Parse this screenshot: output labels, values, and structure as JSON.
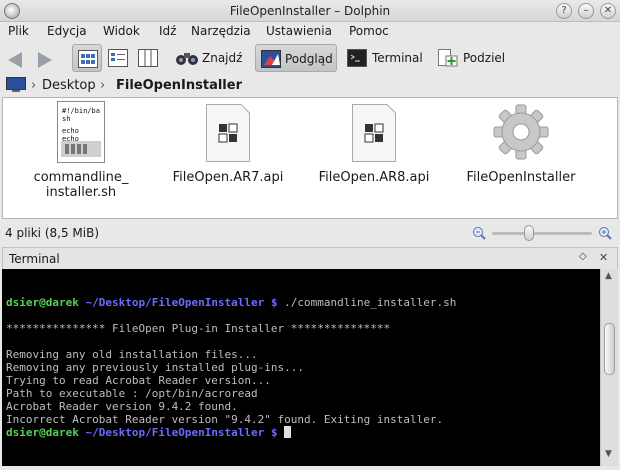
{
  "window": {
    "title": "FileOpenInstaller – Dolphin"
  },
  "menu": [
    "Plik",
    "Edycja",
    "Widok",
    "Idź",
    "Narzędzia",
    "Ustawienia",
    "Pomoc"
  ],
  "toolbar": {
    "find": "Znajdź",
    "preview": "Podgląd",
    "terminal": "Terminal",
    "split": "Podziel"
  },
  "breadcrumb": {
    "parent": "Desktop",
    "current": "FileOpenInstaller"
  },
  "files": [
    {
      "name_line1": "commandline_",
      "name_line2": "installer.sh",
      "preview_lines": [
        "#!/bin/ba",
        "sh",
        "echo",
        "echo"
      ]
    },
    {
      "name_line1": "FileOpen.AR7.api",
      "name_line2": ""
    },
    {
      "name_line1": "FileOpen.AR8.api",
      "name_line2": ""
    },
    {
      "name_line1": "FileOpenInstaller",
      "name_line2": ""
    }
  ],
  "status": {
    "text": "4 pliki (8,5 MiB)",
    "zoom_level": 0.35
  },
  "terminal_panel": {
    "title": "Terminal",
    "user": "dsier@darek",
    "path": "~/Desktop/FileOpenInstaller $",
    "command": " ./commandline_installer.sh",
    "banner": "*************** FileOpen Plug-in Installer ***************",
    "output": [
      "Removing any old installation files...",
      "Removing any previously installed plug-ins...",
      "Trying to read Acrobat Reader version...",
      "Path to executable : /opt/bin/acroread",
      "Acrobat Reader version 9.4.2 found.",
      "Incorrect Acrobat Reader version \"9.4.2\" found. Exiting installer."
    ]
  },
  "colors": {
    "prompt_user": "#55d255",
    "prompt_path": "#6b6bff",
    "terminal_bg": "#000000",
    "terminal_text": "#bdbdbd"
  }
}
